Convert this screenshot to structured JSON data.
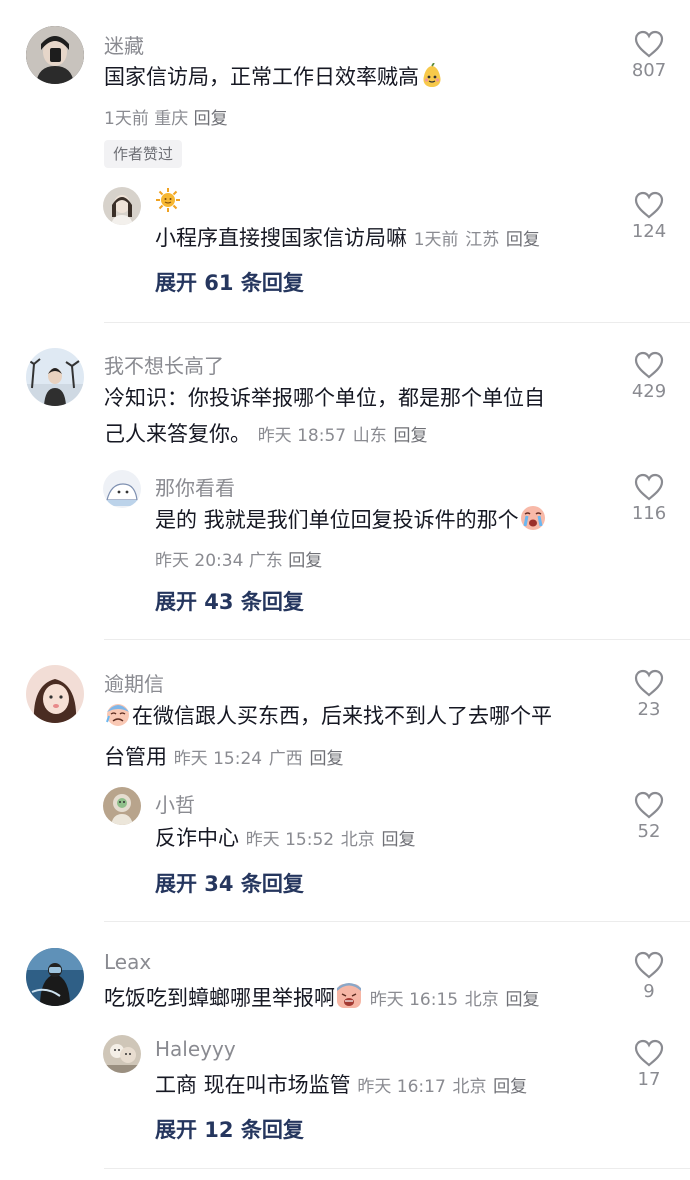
{
  "comments": [
    {
      "user": "迷藏",
      "text": "国家信访局，正常工作日效率贼高",
      "time": "1天前",
      "location": "重庆",
      "reply_label": "回复",
      "badge": "作者赞过",
      "likes": "807",
      "reply": {
        "user": "",
        "text": "小程序直接搜国家信访局嘛",
        "time": "1天前",
        "location": "江苏",
        "reply_label": "回复",
        "likes": "124"
      },
      "expand": "展开 61 条回复"
    },
    {
      "user": "我不想长高了",
      "text_line1": "冷知识：你投诉举报哪个单位，都是那个单位自",
      "text_line2": "己人来答复你。",
      "time": "昨天 18:57",
      "location": "山东",
      "reply_label": "回复",
      "likes": "429",
      "reply": {
        "user": "那你看看",
        "text": "是的 我就是我们单位回复投诉件的那个",
        "time": "昨天 20:34",
        "location": "广东",
        "reply_label": "回复",
        "likes": "116"
      },
      "expand": "展开 43 条回复"
    },
    {
      "user": "逾期信",
      "text_line1": "在微信跟人买东西，后来找不到人了去哪个平",
      "text_line2": "台管用",
      "time": "昨天 15:24",
      "location": "广西",
      "reply_label": "回复",
      "likes": "23",
      "reply": {
        "user": "小哲",
        "text": "反诈中心",
        "time": "昨天 15:52",
        "location": "北京",
        "reply_label": "回复",
        "likes": "52"
      },
      "expand": "展开 34 条回复"
    },
    {
      "user": "Leax",
      "text": "吃饭吃到蟑螂哪里举报啊",
      "time": "昨天 16:15",
      "location": "北京",
      "reply_label": "回复",
      "likes": "9",
      "reply": {
        "user": "Haleyyy",
        "text": "工商 现在叫市场监管",
        "time": "昨天 16:17",
        "location": "北京",
        "reply_label": "回复",
        "likes": "17"
      },
      "expand": "展开 12 条回复"
    }
  ],
  "icons": {
    "like": "heart-outline-icon",
    "emoji_pear": "pear-face-emoji",
    "emoji_sun": "sun-emoji",
    "emoji_crying": "crying-face-emoji",
    "emoji_sweat": "anxious-face-emoji",
    "emoji_angry": "distressed-face-emoji"
  },
  "colors": {
    "link": "#25365e",
    "secondary_text": "#8a8b91",
    "primary_text": "#161823",
    "badge_bg": "#f2f2f4",
    "heart": "#8a8b91"
  }
}
